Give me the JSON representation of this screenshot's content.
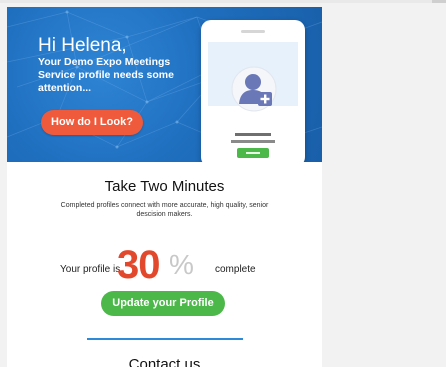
{
  "hero": {
    "greeting": "Hi Helena,",
    "message": "Your Demo Expo Meetings Service profile needs some attention...",
    "cta_label": "How do I Look?"
  },
  "main": {
    "title": "Take Two Minutes",
    "subtitle": "Completed profiles connect with more accurate, high quality, senior descision makers.",
    "progress": {
      "before": "Your profile is",
      "value": "30",
      "percent_sign": "%",
      "after": "complete"
    },
    "update_label": "Update your Profile",
    "contact_title": "Contact us"
  },
  "colors": {
    "hero_blue": "#1f6fbf",
    "cta_orange": "#ee5a3b",
    "percent_red": "#e2492c",
    "button_green": "#4db84a",
    "divider_blue": "#2d8ad6"
  },
  "icons": [
    "add-user-icon",
    "phone-illustration"
  ]
}
